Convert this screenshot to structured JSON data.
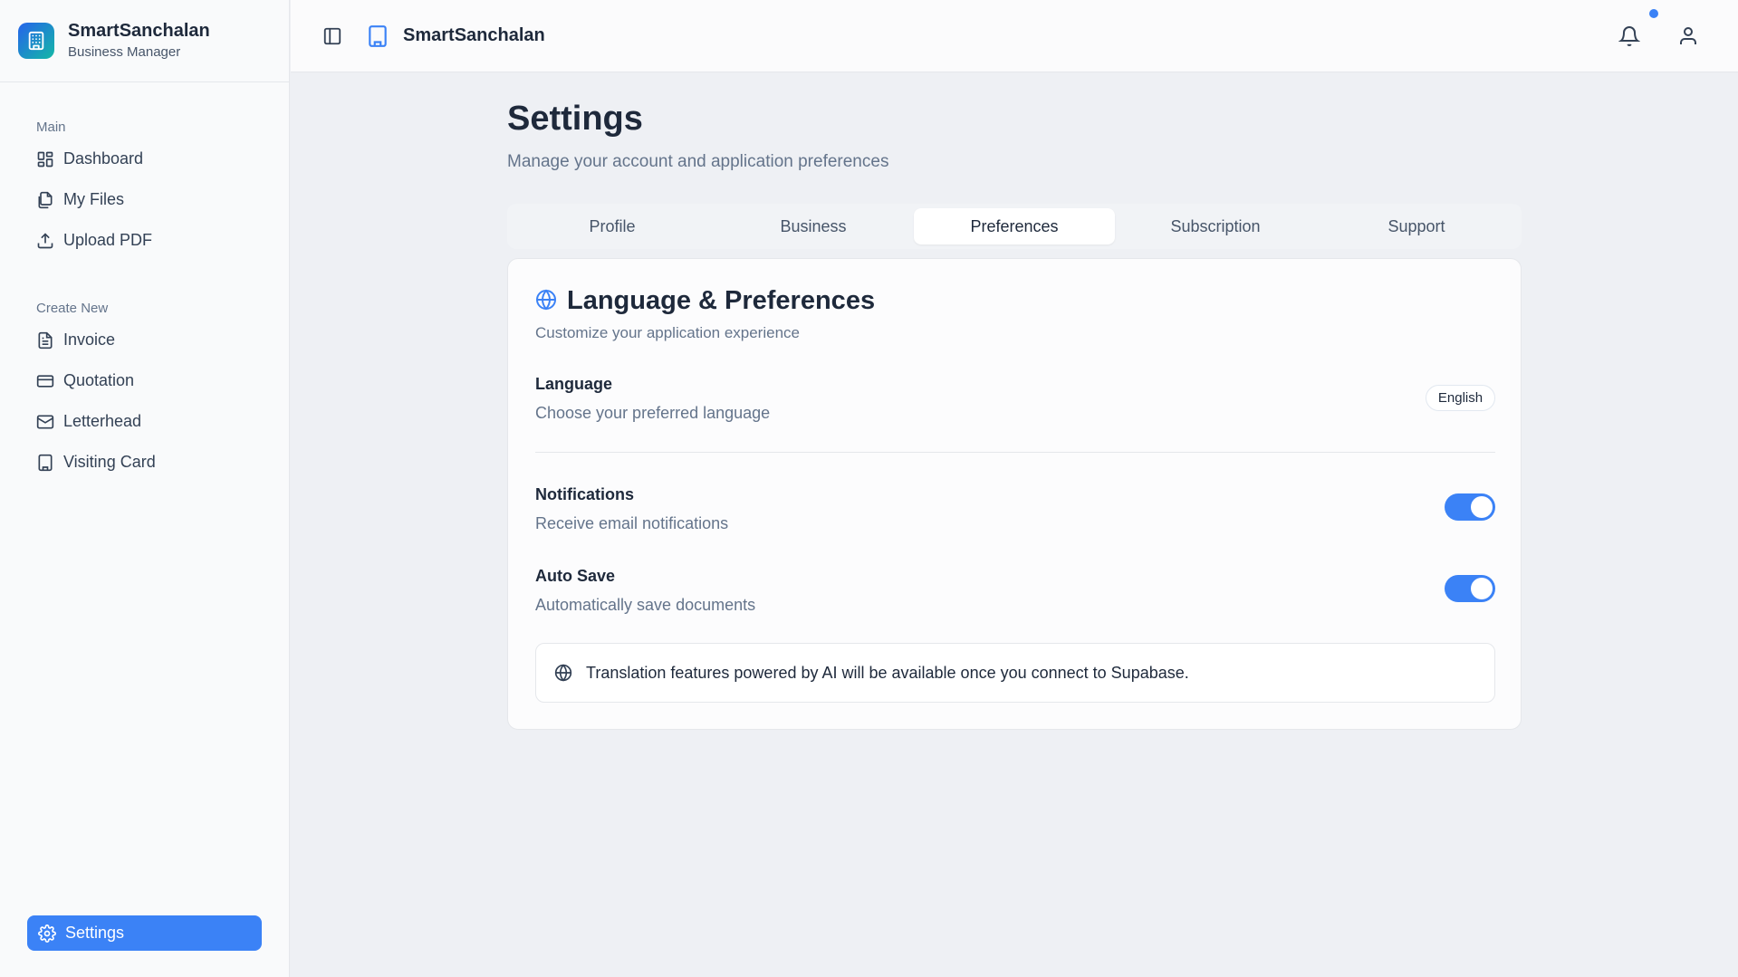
{
  "brand": {
    "name": "SmartSanchalan",
    "subtitle": "Business Manager"
  },
  "sidebar": {
    "main_title": "Main",
    "main_items": [
      {
        "label": "Dashboard",
        "icon": "grid-icon"
      },
      {
        "label": "My Files",
        "icon": "files-icon"
      },
      {
        "label": "Upload PDF",
        "icon": "upload-icon"
      }
    ],
    "create_title": "Create New",
    "create_items": [
      {
        "label": "Invoice",
        "icon": "document-icon"
      },
      {
        "label": "Quotation",
        "icon": "card-icon"
      },
      {
        "label": "Letterhead",
        "icon": "mail-icon"
      },
      {
        "label": "Visiting Card",
        "icon": "building-icon"
      }
    ],
    "settings_label": "Settings"
  },
  "header": {
    "title": "SmartSanchalan"
  },
  "page": {
    "title": "Settings",
    "subtitle": "Manage your account and application preferences"
  },
  "tabs": [
    {
      "label": "Profile"
    },
    {
      "label": "Business"
    },
    {
      "label": "Preferences"
    },
    {
      "label": "Subscription"
    },
    {
      "label": "Support"
    }
  ],
  "active_tab": "Preferences",
  "card": {
    "title": "Language & Preferences",
    "subtitle": "Customize your application experience",
    "language": {
      "label": "Language",
      "desc": "Choose your preferred language",
      "value": "English"
    },
    "notifications": {
      "label": "Notifications",
      "desc": "Receive email notifications",
      "enabled": true
    },
    "auto_save": {
      "label": "Auto Save",
      "desc": "Automatically save documents",
      "enabled": true
    },
    "info": "Translation features powered by AI will be available once you connect to Supabase."
  },
  "colors": {
    "accent": "#3b82f6",
    "brand_gradient_start": "#2563eb",
    "brand_gradient_end": "#14b8a6"
  }
}
